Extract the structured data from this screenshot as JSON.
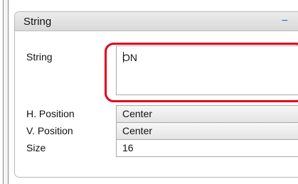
{
  "panel": {
    "title": "String",
    "collapse_icon": "−"
  },
  "fields": {
    "string_label": "String",
    "string_value": "ON",
    "hpos_label": "H. Position",
    "hpos_value": "Center",
    "vpos_label": "V. Position",
    "vpos_value": "Center",
    "size_label": "Size",
    "size_value": "16"
  },
  "colors": {
    "highlight": "#e0001c",
    "accent": "#2a6fb6"
  }
}
